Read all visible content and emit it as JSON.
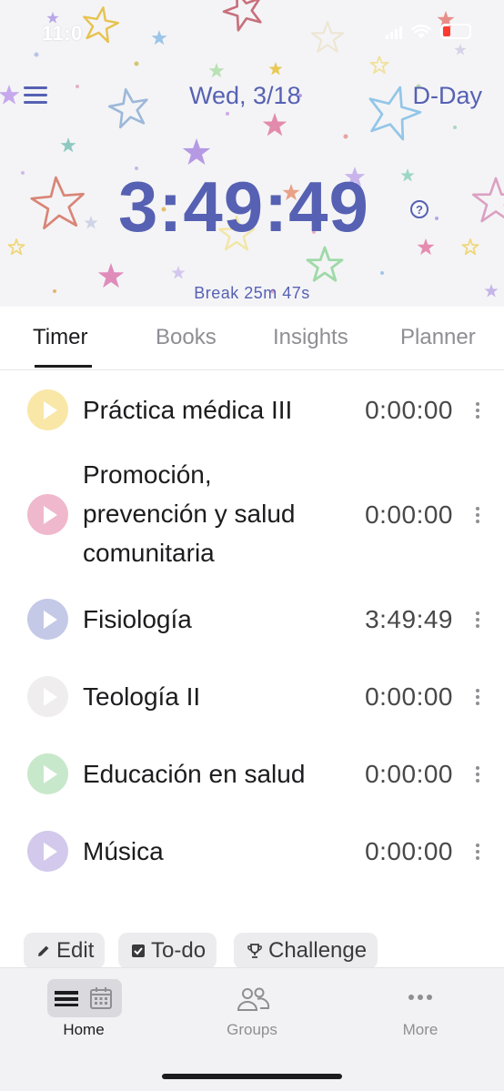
{
  "status_bar": {
    "time": "11:0"
  },
  "header": {
    "date": "Wed, 3/18",
    "dday": "D-Day",
    "timer": "3:49:49",
    "help": "?",
    "break_text": "Break 25m 47s",
    "timer_color": "#5661b3"
  },
  "tabs": [
    {
      "label": "Timer"
    },
    {
      "label": "Books"
    },
    {
      "label": "Insights"
    },
    {
      "label": "Planner"
    }
  ],
  "subjects": [
    {
      "name": "Práctica médica III",
      "time": "0:00:00",
      "color": "#f9e7a7"
    },
    {
      "name": "Promoción, prevención y salud comunitaria",
      "time": "0:00:00",
      "color": "#f0b8cc"
    },
    {
      "name": "Fisiología",
      "time": "3:49:49",
      "color": "#c4c9e8"
    },
    {
      "name": "Teología II",
      "time": "0:00:00",
      "color": "#efedee"
    },
    {
      "name": "Educación en salud",
      "time": "0:00:00",
      "color": "#c8e8cb"
    },
    {
      "name": "Música",
      "time": "0:00:00",
      "color": "#d3c9ec"
    }
  ],
  "actions": {
    "edit": "Edit",
    "todo": "To-do",
    "challenge": "Challenge"
  },
  "bottom_nav": [
    {
      "label": "Home",
      "icon": "list-calendar-icon"
    },
    {
      "label": "Groups",
      "icon": "people-icon"
    },
    {
      "label": "More",
      "icon": "ellipsis-icon"
    }
  ]
}
